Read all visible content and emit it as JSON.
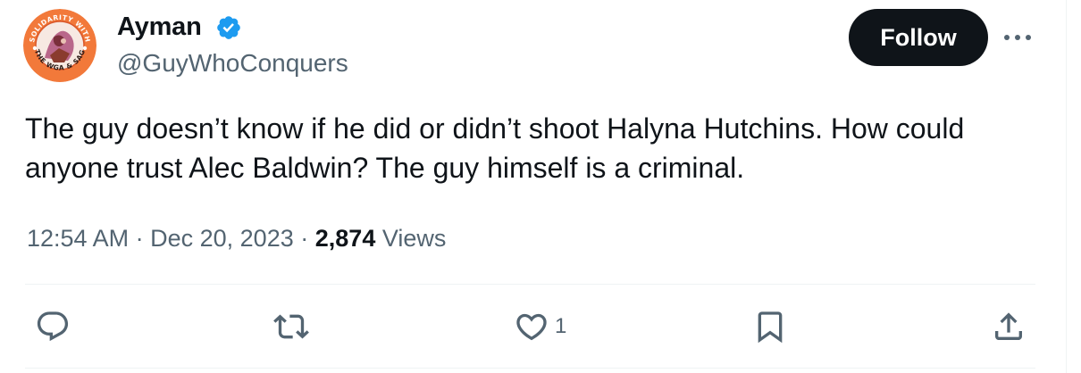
{
  "author": {
    "display_name": "Ayman",
    "handle": "@GuyWhoConquers",
    "verified": true,
    "avatar_badge_text": "SOLIDARITY WITH THE WGA & SAG"
  },
  "follow_button": {
    "label": "Follow"
  },
  "more_menu": {
    "icon": "more-horizontal-icon"
  },
  "tweet": {
    "text": "The guy doesn’t know if he did or didn’t shoot Halyna Hutchins. How could anyone trust Alec Baldwin? The guy himself is a criminal."
  },
  "meta": {
    "time": "12:54 AM",
    "separator": "·",
    "date": "Dec 20, 2023",
    "views_count": "2,874",
    "views_label": "Views"
  },
  "actions": {
    "reply": {
      "icon": "reply-icon"
    },
    "retweet": {
      "icon": "retweet-icon"
    },
    "like": {
      "icon": "heart-icon",
      "count": "1"
    },
    "bookmark": {
      "icon": "bookmark-icon"
    },
    "share": {
      "icon": "share-icon"
    }
  },
  "colors": {
    "text": "#0f1419",
    "secondary": "#536471",
    "verified": "#1d9bf0",
    "follow_bg": "#0f1419",
    "divider": "#eff3f4",
    "avatar_orange": "#f2793a"
  }
}
